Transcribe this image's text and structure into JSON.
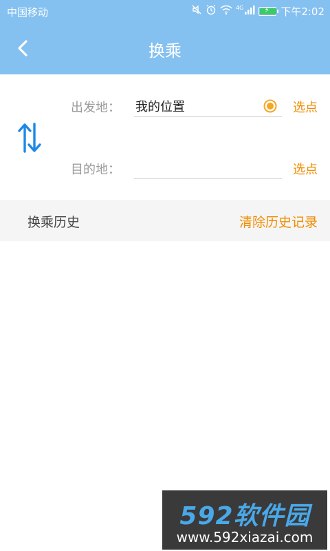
{
  "status_bar": {
    "carrier": "中国移动",
    "network_label": "4G",
    "time": "下午2:02",
    "icons": [
      "mute-icon",
      "alarm-icon",
      "wifi-icon",
      "signal-icon",
      "battery-icon"
    ]
  },
  "header": {
    "title": "换乘",
    "back_icon": "chevron-left-icon"
  },
  "form": {
    "from": {
      "label": "出发地：",
      "value": "我的位置",
      "pick_label": "选点"
    },
    "to": {
      "label": "目的地：",
      "value": "",
      "pick_label": "选点"
    },
    "swap_icon": "swap-arrows-icon"
  },
  "history": {
    "title": "换乘历史",
    "clear_label": "清除历史记录"
  },
  "watermark": {
    "logo_text": "592软件园",
    "url": "www.592xiazai.com"
  },
  "colors": {
    "primary": "#84c0f0",
    "accent": "#f08c00",
    "swap_icon": "#1e88e5",
    "battery": "#3cc96a"
  }
}
